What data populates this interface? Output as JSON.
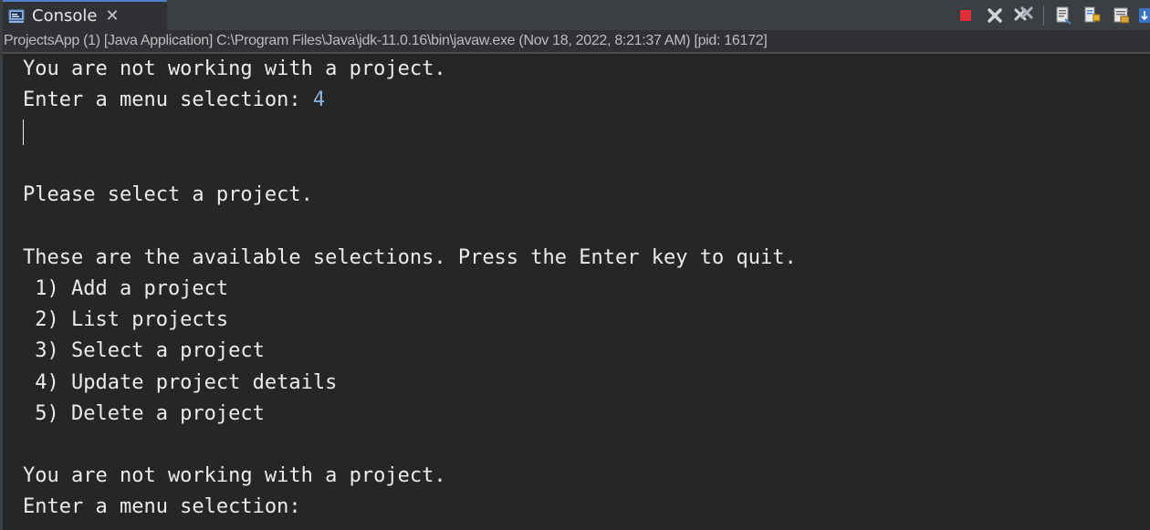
{
  "tab": {
    "label": "Console",
    "close_glyph": "✕",
    "icon": "console-icon"
  },
  "toolbar": {
    "icons": [
      "terminate-icon",
      "remove-launch-icon",
      "remove-all-terminated-icon",
      "clear-console-icon",
      "scroll-lock-icon",
      "word-wrap-icon",
      "pin-console-icon"
    ],
    "colors": {
      "terminate": "#e0303a",
      "remove": "#cfd4da"
    }
  },
  "infobar": {
    "text": "ProjectsApp (1) [Java Application] C:\\Program Files\\Java\\jdk-11.0.16\\bin\\javaw.exe  (Nov 18, 2022, 8:21:37 AM) [pid: 16172]"
  },
  "console": {
    "lines": [
      {
        "text": "You are not working with a project."
      },
      {
        "text": "Enter a menu selection: ",
        "input": "4"
      },
      {
        "text": "Please select a project."
      },
      {
        "text": "These are the available selections. Press the Enter key to quit."
      },
      {
        "text": " 1) Add a project"
      },
      {
        "text": " 2) List projects"
      },
      {
        "text": " 3) Select a project"
      },
      {
        "text": " 4) Update project details"
      },
      {
        "text": " 5) Delete a project"
      },
      {
        "text": "You are not working with a project."
      },
      {
        "text": "Enter a menu selection:"
      }
    ]
  },
  "colors": {
    "background": "#262626",
    "text": "#ebebeb",
    "input": "#8cb4dc",
    "tab_accent": "#4f7fc4"
  }
}
